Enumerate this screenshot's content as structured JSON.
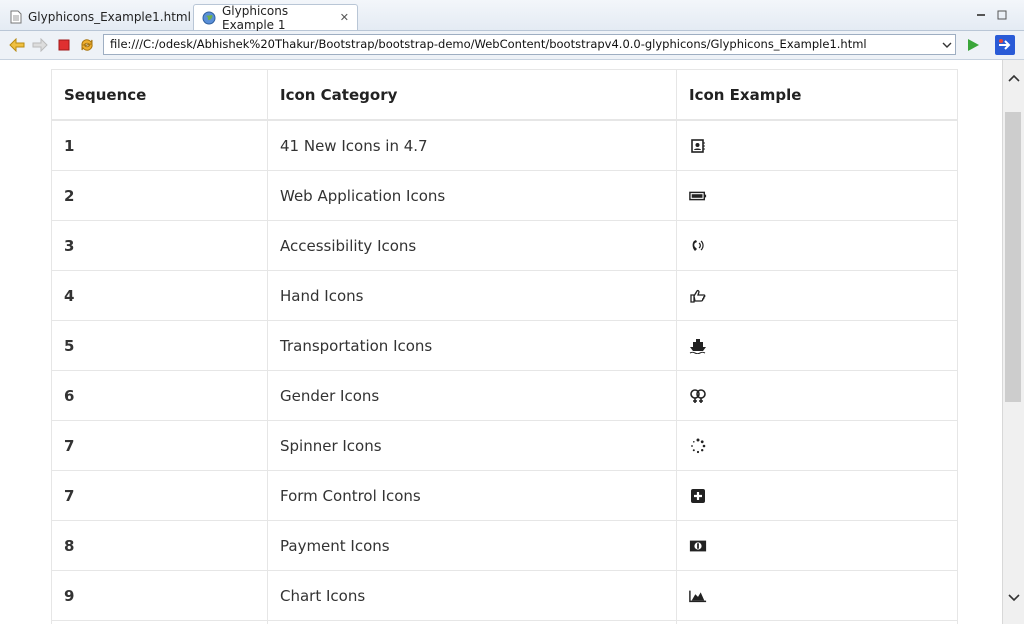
{
  "tabs": [
    {
      "label": "Glyphicons_Example1.html",
      "icon": "document-icon",
      "active": false
    },
    {
      "label": "Glyphicons Example 1",
      "icon": "globe-icon",
      "active": true,
      "close": "✕"
    }
  ],
  "address": {
    "url": "file:///C:/odesk/Abhishek%20Thakur/Bootstrap/bootstrap-demo/WebContent/bootstrapv4.0.0-glyphicons/Glyphicons_Example1.html"
  },
  "table": {
    "headers": [
      "Sequence",
      "Icon Category",
      "Icon Example"
    ],
    "rows": [
      {
        "seq": "1",
        "category": "41 New Icons in 4.7",
        "icon": "address-card-icon"
      },
      {
        "seq": "2",
        "category": "Web Application Icons",
        "icon": "battery-icon"
      },
      {
        "seq": "3",
        "category": "Accessibility Icons",
        "icon": "volume-control-phone-icon"
      },
      {
        "seq": "4",
        "category": "Hand Icons",
        "icon": "hand-pointing-right-icon"
      },
      {
        "seq": "5",
        "category": "Transportation Icons",
        "icon": "ship-icon"
      },
      {
        "seq": "6",
        "category": "Gender Icons",
        "icon": "venus-double-icon"
      },
      {
        "seq": "7",
        "category": "Spinner Icons",
        "icon": "spinner-icon"
      },
      {
        "seq": "7",
        "category": "Form Control Icons",
        "icon": "plus-square-icon"
      },
      {
        "seq": "8",
        "category": "Payment Icons",
        "icon": "money-icon"
      },
      {
        "seq": "9",
        "category": "Chart Icons",
        "icon": "area-chart-icon"
      }
    ]
  },
  "colors": {
    "play": "#3aa63a",
    "stop": "#e03030",
    "accent": "#2a5bd7"
  }
}
